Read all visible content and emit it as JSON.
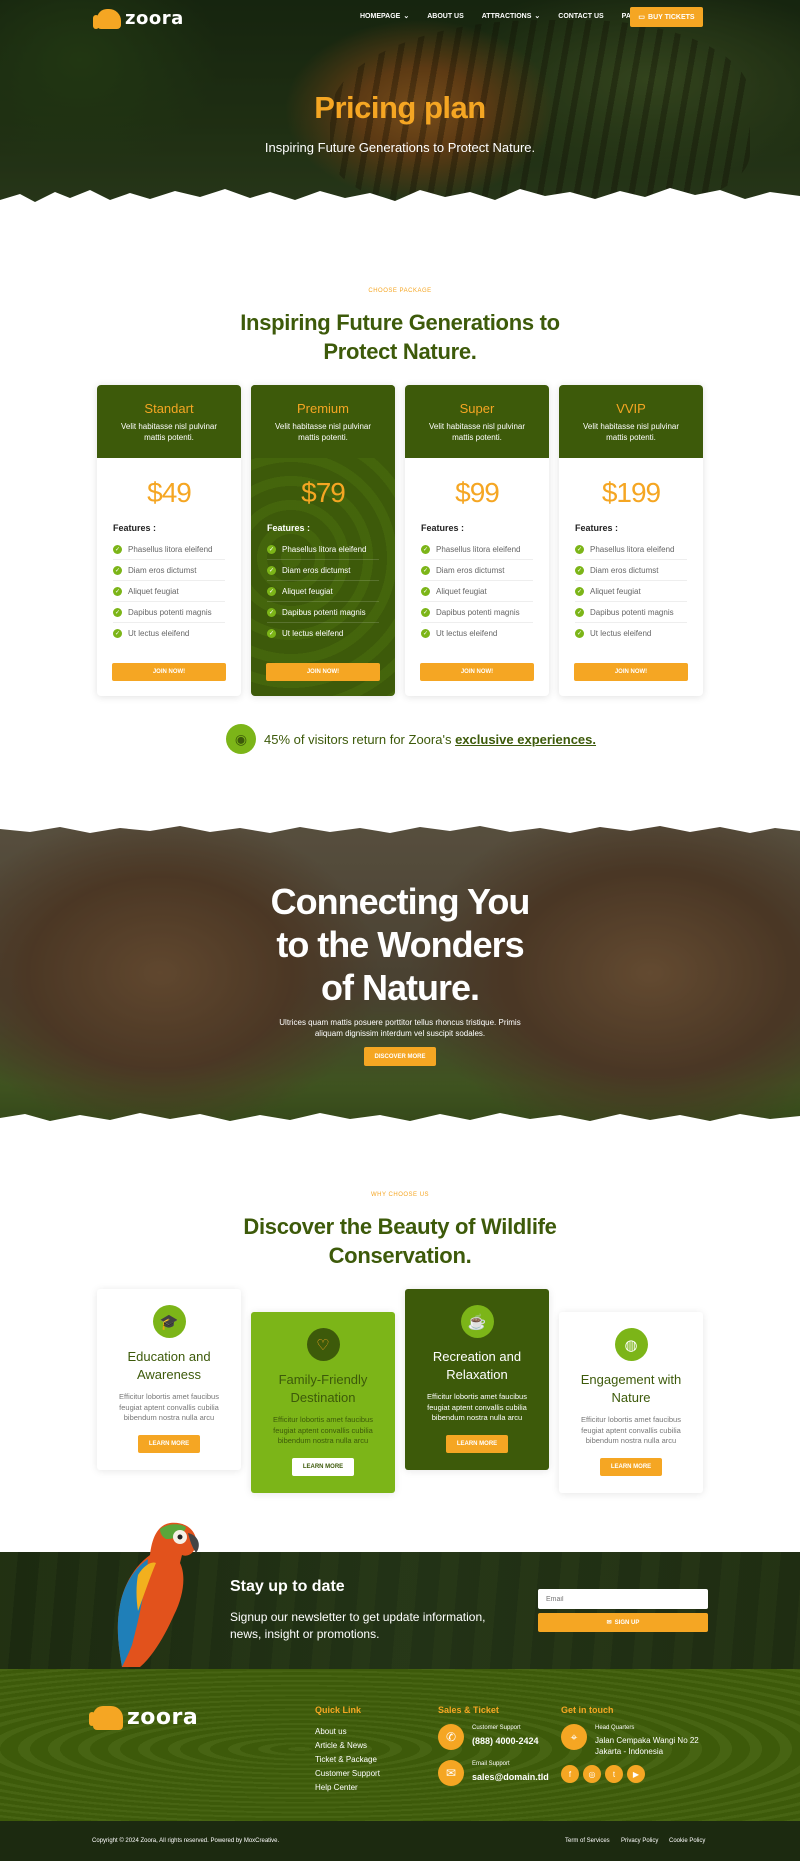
{
  "brand": {
    "name": "zoora"
  },
  "nav": {
    "items": [
      {
        "label": "HOMEPAGE",
        "dropdown": true
      },
      {
        "label": "ABOUT US",
        "dropdown": false
      },
      {
        "label": "ATTRACTIONS",
        "dropdown": true
      },
      {
        "label": "CONTACT US",
        "dropdown": false
      },
      {
        "label": "PAGES",
        "dropdown": true
      }
    ],
    "cta": "BUY TICKETS"
  },
  "hero": {
    "title": "Pricing plan",
    "subtitle": "Inspiring Future Generations to Protect Nature."
  },
  "pricing": {
    "eyebrow": "CHOOSE PACKAGE",
    "title_line1": "Inspiring Future Generations to",
    "title_line2": "Protect Nature.",
    "features_label": "Features :",
    "join_label": "JOIN NOW!",
    "plans": [
      {
        "name": "Standart",
        "desc": "Velit habitasse nisl pulvinar mattis potenti.",
        "price": "$49"
      },
      {
        "name": "Premium",
        "desc": "Velit habitasse nisl pulvinar mattis potenti.",
        "price": "$79"
      },
      {
        "name": "Super",
        "desc": "Velit habitasse nisl pulvinar mattis potenti.",
        "price": "$99"
      },
      {
        "name": "VVIP",
        "desc": "Velit habitasse nisl pulvinar mattis potenti.",
        "price": "$199"
      }
    ],
    "features": [
      "Phasellus litora eleifend",
      "Diam eros dictumst",
      "Aliquet feugiat",
      "Dapibus potenti magnis",
      "Ut lectus eleifend"
    ]
  },
  "visitors": {
    "text": "45% of visitors return for Zoora's",
    "link": "exclusive experiences."
  },
  "rhino": {
    "title_line1": "Connecting You",
    "title_line2": "to the Wonders",
    "title_line3": "of Nature.",
    "sub_line1": "Ultrices quam mattis posuere porttitor tellus rhoncus tristique. Primis",
    "sub_line2": "aliquam dignissim interdum vel suscipit sodales.",
    "cta": "DISCOVER MORE"
  },
  "why": {
    "eyebrow": "WHY CHOOSE US",
    "title_line1": "Discover the Beauty of Wildlife",
    "title_line2": "Conservation.",
    "cards": [
      {
        "title_line1": "Education and",
        "title_line2": "Awareness",
        "desc_line1": "Efficitur lobortis amet faucibus",
        "desc_line2": "feugiat aptent convallis cubilia",
        "desc_line3": "bibendum nostra nulla arcu",
        "cta": "LEARN MORE",
        "icon": "graduation-cap-icon"
      },
      {
        "title_line1": "Family-Friendly",
        "title_line2": "Destination",
        "desc_line1": "Efficitur lobortis amet faucibus",
        "desc_line2": "feugiat aptent convallis cubilia",
        "desc_line3": "bibendum nostra nulla arcu",
        "cta": "LEARN MORE",
        "icon": "heart-hand-icon"
      },
      {
        "title_line1": "Recreation and",
        "title_line2": "Relaxation",
        "desc_line1": "Efficitur lobortis amet faucibus",
        "desc_line2": "feugiat aptent convallis cubilia",
        "desc_line3": "bibendum nostra nulla arcu",
        "cta": "LEARN MORE",
        "icon": "coffee-cup-icon"
      },
      {
        "title_line1": "Engagement with",
        "title_line2": "Nature",
        "desc_line1": "Efficitur lobortis amet faucibus",
        "desc_line2": "feugiat aptent convallis cubilia",
        "desc_line3": "bibendum nostra nulla arcu",
        "cta": "LEARN MORE",
        "icon": "globe-icon"
      }
    ]
  },
  "newsletter": {
    "title": "Stay up to date",
    "sub": "Signup our newsletter to get update information, news, insight or promotions.",
    "placeholder": "Email",
    "cta": "SIGN UP"
  },
  "footer": {
    "quick_link_title": "Quick Link",
    "quick_links": [
      "About us",
      "Article & News",
      "Ticket & Package",
      "Customer Support",
      "Help Center"
    ],
    "sales_title": "Sales & Ticket",
    "support_label": "Customer Support",
    "support_phone": "(888) 4000-2424",
    "email_label": "Email Support",
    "email": "sales@domain.tld",
    "touch_title": "Get in touch",
    "hq_label": "Head Quarters",
    "hq_line1": "Jalan Cempaka Wangi No 22",
    "hq_line2": "Jakarta - Indonesia",
    "copyright": "Copyright © 2024 Zoora, All rights reserved. Powered by MoxCreative.",
    "legal": [
      "Term of Services",
      "Privacy Policy",
      "Cookie Policy"
    ]
  },
  "colors": {
    "primary_green": "#3d5a0a",
    "accent_orange": "#f5a623",
    "lime": "#7cb518",
    "dark": "#1c2a10"
  }
}
